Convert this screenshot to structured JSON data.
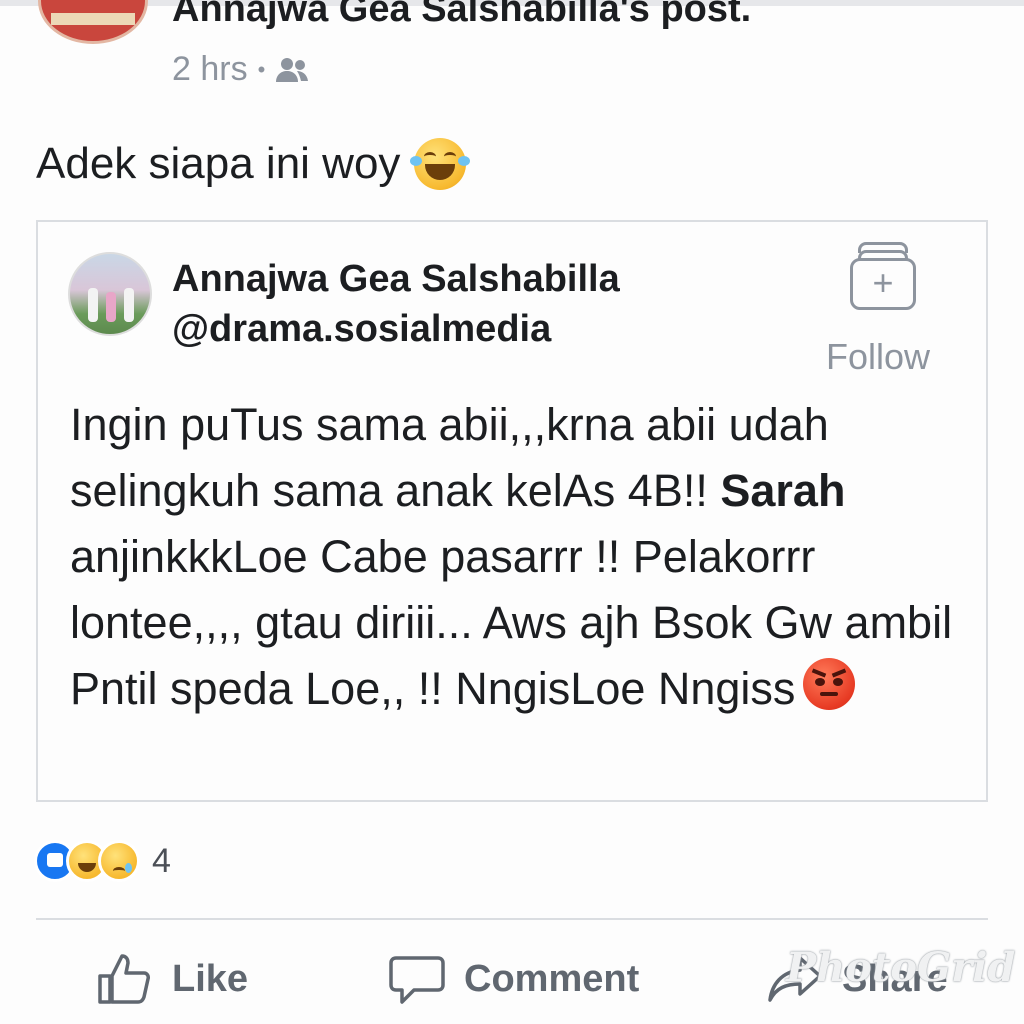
{
  "header": {
    "shared_text": "Annajwa Gea Salshabilla's post.",
    "time": "2 hrs",
    "separator": "•",
    "audience_icon": "friends-icon"
  },
  "caption": {
    "text": "Adek siapa ini woy",
    "emoji": "laughing-tears-emoji"
  },
  "shared_post": {
    "author_name": "Annajwa Gea Salshabilla",
    "overlay_handle": "@drama.sosialmedia",
    "follow_label": "Follow",
    "text_before_bold": "Ingin puTus sama abii,,,krna abii udah selingkuh sama anak kelAs 4B!! ",
    "bold_name": "Sarah",
    "text_after_bold": " anjinkkkLoe Cabe pasarrr !! Pelakorrr lontee,,,, gtau diriii... Aws ajh Bsok Gw ambil Pntil speda Loe,, !! NngisLoe Nngiss",
    "end_emoji": "angry-face-emoji"
  },
  "reactions": {
    "icons": [
      "like-reaction-icon",
      "haha-reaction-icon",
      "sad-reaction-icon"
    ],
    "count": "4"
  },
  "actions": {
    "like_label": "Like",
    "comment_label": "Comment",
    "share_label": "Share"
  },
  "watermark": "PhotoGrid",
  "colors": {
    "text": "#1c1e21",
    "muted": "#8d949e",
    "action_gray": "#606770",
    "like_blue": "#1877f2",
    "border": "#dadde1"
  }
}
